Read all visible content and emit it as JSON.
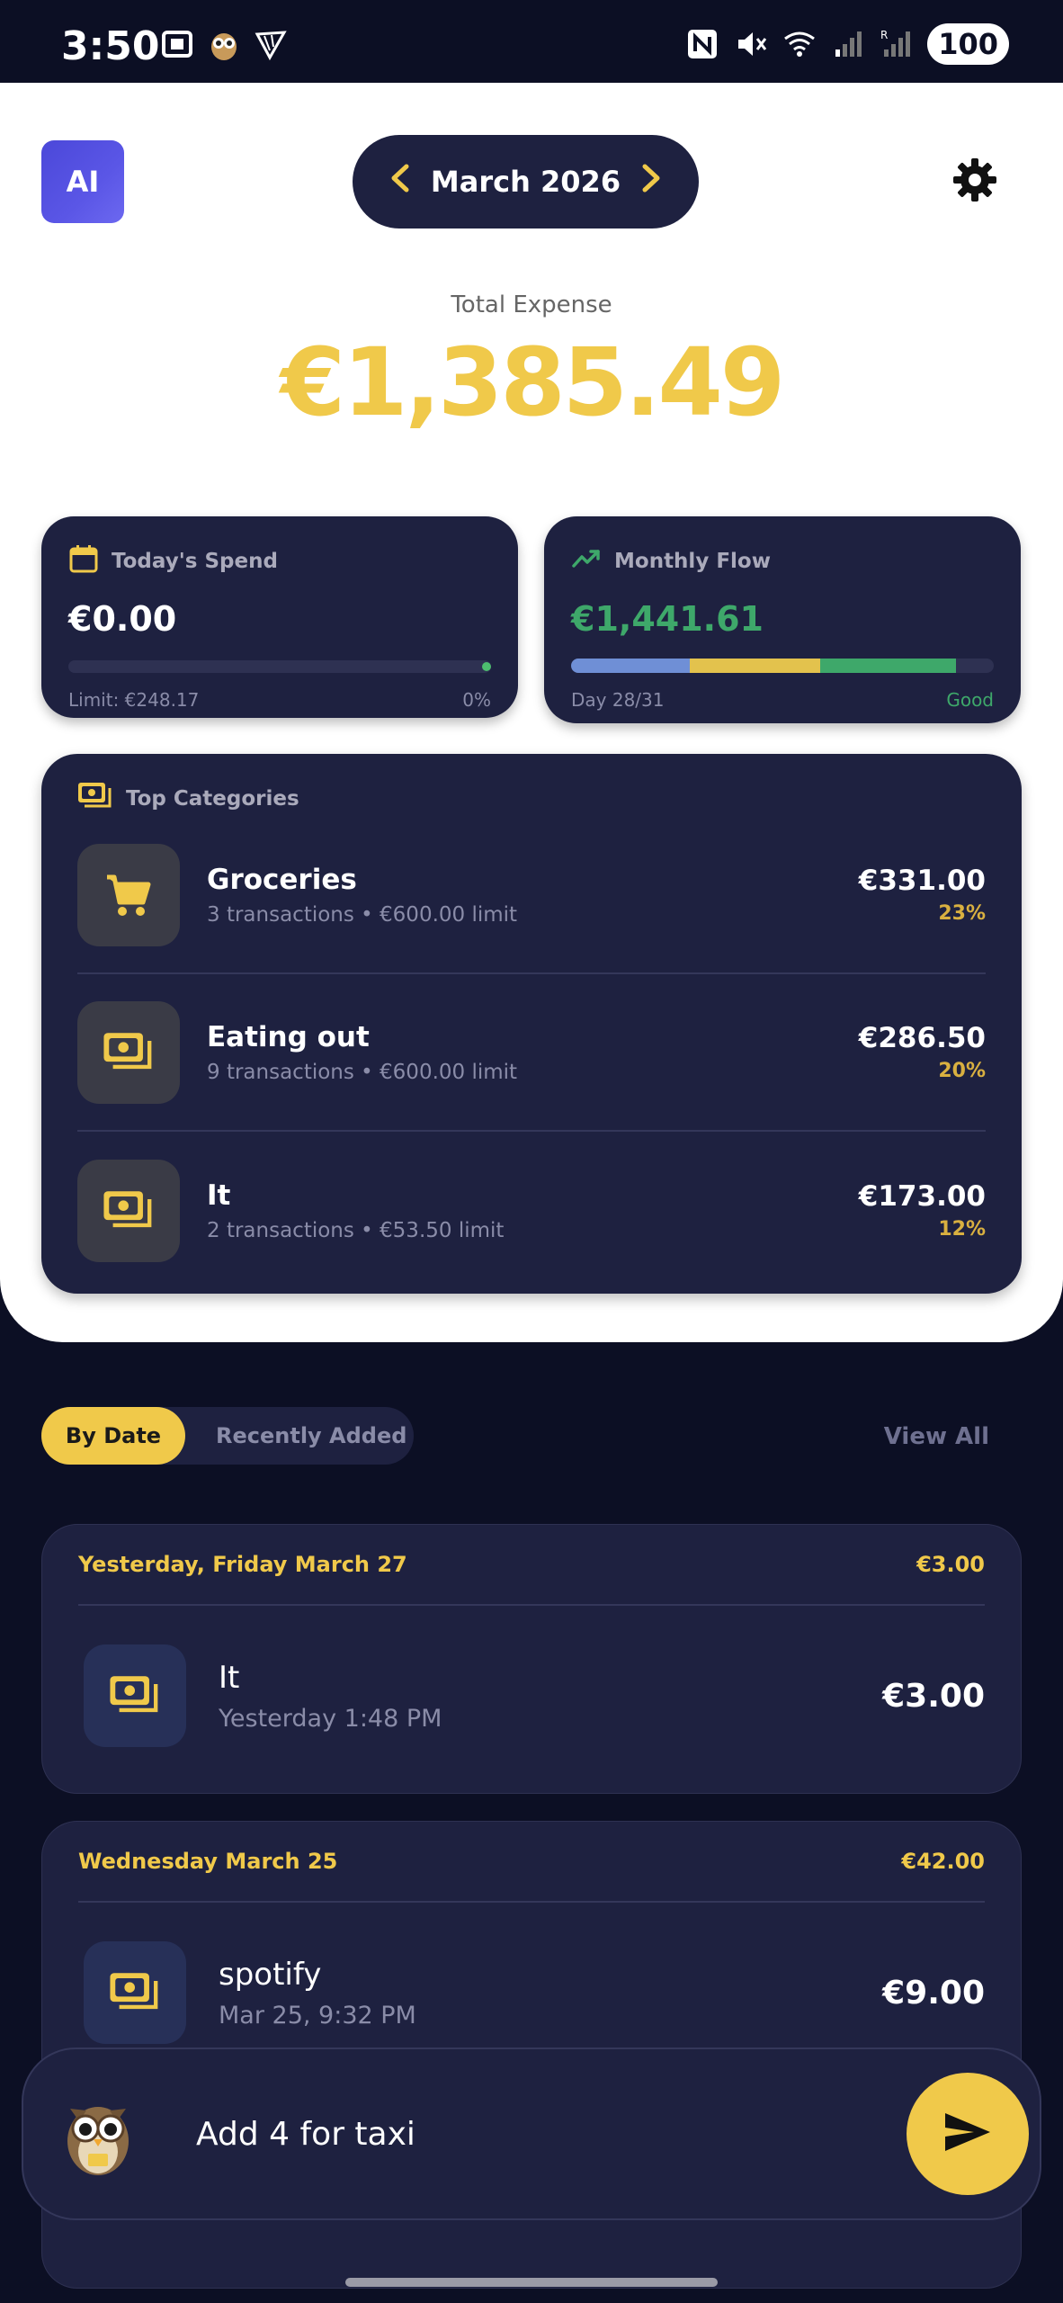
{
  "status_bar": {
    "time": "3:50",
    "battery": "100",
    "icons": [
      "screenshot-icon",
      "owl-app-icon",
      "ryanair-icon",
      "nfc-icon",
      "mute-icon",
      "wifi-icon",
      "signal-icon",
      "signal-roaming-icon"
    ]
  },
  "header": {
    "ai_label": "AI",
    "month": "March 2026",
    "prev_icon": "chevron-left-icon",
    "next_icon": "chevron-right-icon",
    "settings_icon": "gear-icon"
  },
  "total": {
    "label": "Total Expense",
    "value": "€1,385.49"
  },
  "today_spend": {
    "title": "Today's Spend",
    "value": "€0.00",
    "limit": "Limit: €248.17",
    "percent": "0%",
    "progress": 0
  },
  "monthly_flow": {
    "title": "Monthly Flow",
    "value": "€1,441.61",
    "day": "Day 28/31",
    "status": "Good",
    "segments": [
      {
        "color": "#6f8fd6",
        "fraction": 0.28
      },
      {
        "color": "#e3c24d",
        "fraction": 0.31
      },
      {
        "color": "#3ea86a",
        "fraction": 0.32
      }
    ]
  },
  "top_categories": {
    "title": "Top Categories",
    "items": [
      {
        "name": "Groceries",
        "sub": "3 transactions • €600.00 limit",
        "amount": "€331.00",
        "pct": "23%",
        "icon": "cart-icon"
      },
      {
        "name": "Eating out",
        "sub": "9 transactions • €600.00 limit",
        "amount": "€286.50",
        "pct": "20%",
        "icon": "cash-icon"
      },
      {
        "name": "It",
        "sub": "2 transactions • €53.50 limit",
        "amount": "€173.00",
        "pct": "12%",
        "icon": "cash-icon"
      }
    ]
  },
  "list_controls": {
    "by_date": "By Date",
    "recently_added": "Recently Added",
    "view_all": "View All"
  },
  "days": [
    {
      "header": "Yesterday, Friday March 27",
      "total": "€3.00",
      "tx": {
        "name": "It",
        "time": "Yesterday 1:48 PM",
        "amount": "€3.00"
      }
    },
    {
      "header": "Wednesday March 25",
      "total": "€42.00",
      "tx": {
        "name": "spotify",
        "time": "Mar 25, 9:32 PM",
        "amount": "€9.00"
      }
    }
  ],
  "input": {
    "text": "Add 4 for taxi",
    "send_icon": "send-icon",
    "avatar_icon": "owl-icon"
  },
  "colors": {
    "accent": "#f0c94a",
    "dark": "#0c0f24",
    "card": "#1e2140",
    "positive": "#3ea86a"
  }
}
